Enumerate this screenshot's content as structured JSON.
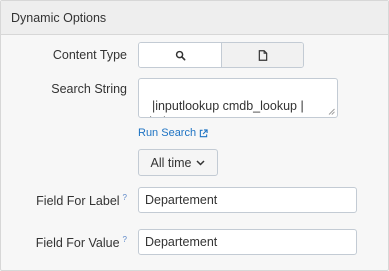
{
  "panel": {
    "title": "Dynamic Options"
  },
  "content_type": {
    "label": "Content Type",
    "options": [
      {
        "icon": "search-icon",
        "selected": true
      },
      {
        "icon": "document-icon",
        "selected": false
      }
    ]
  },
  "search_string": {
    "label": "Search String",
    "value": "|inputlookup cmdb_lookup | dedup\nDepartement"
  },
  "run_search": {
    "label": "Run Search"
  },
  "time_range": {
    "label": "All time"
  },
  "field_for_label": {
    "label": "Field For Label",
    "help": "?",
    "value": "Departement"
  },
  "field_for_value": {
    "label": "Field For Value",
    "help": "?",
    "value": "Departement"
  },
  "colors": {
    "link": "#1e73c3",
    "help": "#5b86c8",
    "border": "#c3cbd4"
  }
}
